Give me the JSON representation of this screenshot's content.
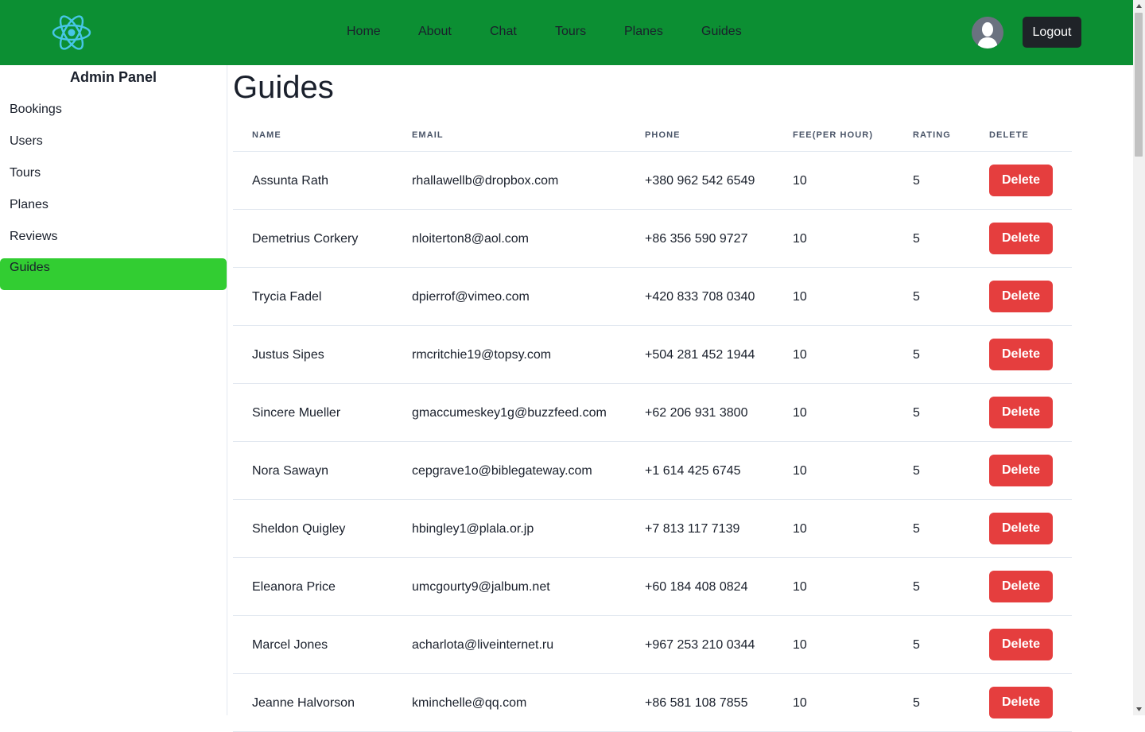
{
  "nav": {
    "items": [
      "Home",
      "About",
      "Chat",
      "Tours",
      "Planes",
      "Guides"
    ],
    "logout_label": "Logout",
    "logo": "react-atom-icon",
    "avatar": "user-avatar-icon"
  },
  "sidebar": {
    "title": "Admin Panel",
    "items": [
      "Bookings",
      "Users",
      "Tours",
      "Planes",
      "Reviews",
      "Guides"
    ],
    "active": "Guides"
  },
  "main": {
    "title": "Guides",
    "columns": [
      "NAME",
      "EMAIL",
      "PHONE",
      "FEE(PER HOUR)",
      "RATING",
      "DELETE"
    ],
    "delete_label": "Delete",
    "rows": [
      {
        "name": "Assunta Rath",
        "email": "rhallawellb@dropbox.com",
        "phone": "+380 962 542 6549",
        "fee": "10",
        "rating": "5"
      },
      {
        "name": "Demetrius Corkery",
        "email": "nloiterton8@aol.com",
        "phone": "+86 356 590 9727",
        "fee": "10",
        "rating": "5"
      },
      {
        "name": "Trycia Fadel",
        "email": "dpierrof@vimeo.com",
        "phone": "+420 833 708 0340",
        "fee": "10",
        "rating": "5"
      },
      {
        "name": "Justus Sipes",
        "email": "rmcritchie19@topsy.com",
        "phone": "+504 281 452 1944",
        "fee": "10",
        "rating": "5"
      },
      {
        "name": "Sincere Mueller",
        "email": "gmaccumeskey1g@buzzfeed.com",
        "phone": "+62 206 931 3800",
        "fee": "10",
        "rating": "5"
      },
      {
        "name": "Nora Sawayn",
        "email": "cepgrave1o@biblegateway.com",
        "phone": "+1 614 425 6745",
        "fee": "10",
        "rating": "5"
      },
      {
        "name": "Sheldon Quigley",
        "email": "hbingley1@plala.or.jp",
        "phone": "+7 813 117 7139",
        "fee": "10",
        "rating": "5"
      },
      {
        "name": "Eleanora Price",
        "email": "umcgourty9@jalbum.net",
        "phone": "+60 184 408 0824",
        "fee": "10",
        "rating": "5"
      },
      {
        "name": "Marcel Jones",
        "email": "acharlota@liveinternet.ru",
        "phone": "+967 253 210 0344",
        "fee": "10",
        "rating": "5"
      },
      {
        "name": "Jeanne Halvorson",
        "email": "kminchelle@qq.com",
        "phone": "+86 581 108 7855",
        "fee": "10",
        "rating": "5"
      }
    ]
  },
  "colors": {
    "header": "#0c8f33",
    "active_sidebar": "#32cd32",
    "delete_button": "#e53e3e",
    "logout_button": "#1f2328"
  }
}
